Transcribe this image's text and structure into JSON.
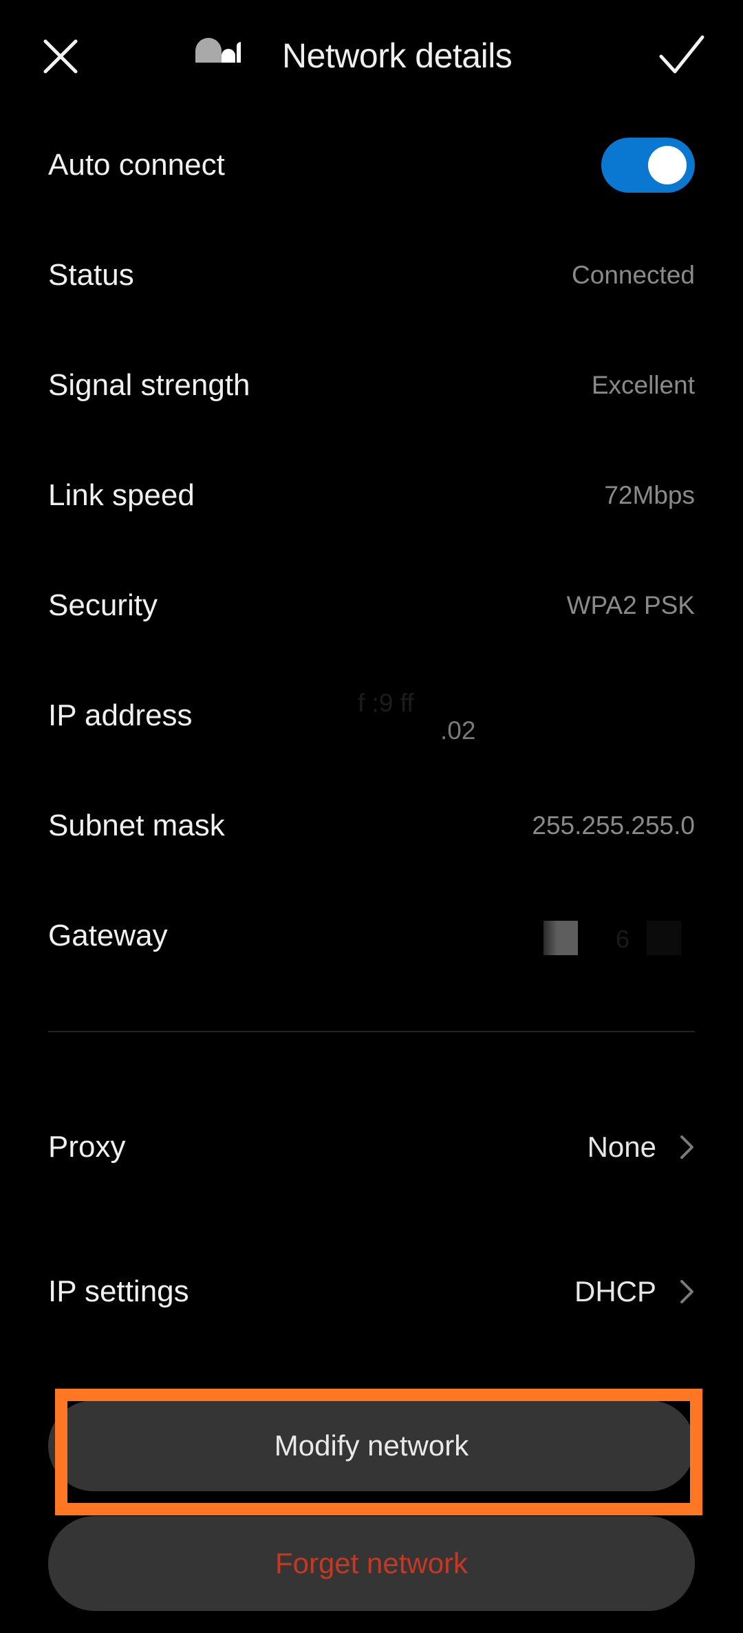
{
  "header": {
    "title": "Network details",
    "close_icon": "close-icon",
    "confirm_icon": "checkmark-icon",
    "ssid_redacted": true
  },
  "auto_connect": {
    "label": "Auto connect",
    "enabled": true,
    "accent_color": "#0A78D1"
  },
  "details": [
    {
      "label": "Status",
      "value": "Connected"
    },
    {
      "label": "Signal strength",
      "value": "Excellent"
    },
    {
      "label": "Link speed",
      "value": "72Mbps"
    },
    {
      "label": "Security",
      "value": "WPA2 PSK"
    },
    {
      "label": "IP address",
      "value_line1": "f  :9   ff",
      "value_line2": ".02",
      "redacted": true
    },
    {
      "label": "Subnet mask",
      "value": "255.255.255.0"
    },
    {
      "label": "Gateway",
      "value": "6",
      "redacted": true
    }
  ],
  "settings": [
    {
      "label": "Proxy",
      "value": "None",
      "icon": "chevron-right-icon"
    },
    {
      "label": "IP settings",
      "value": "DHCP",
      "icon": "chevron-right-icon"
    }
  ],
  "buttons": {
    "modify": "Modify network",
    "forget": "Forget network",
    "forget_color": "#C53822",
    "highlight_color": "#FF7722"
  }
}
